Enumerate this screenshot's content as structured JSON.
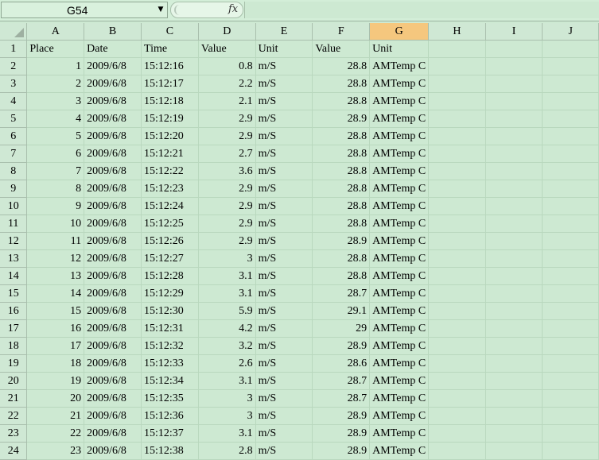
{
  "name_box": {
    "value": "G54",
    "dropdown_icon": "chevron-down-icon"
  },
  "formula": {
    "fx_label": "fx",
    "value": ""
  },
  "grid": {
    "selected_column": "G",
    "columns": [
      "A",
      "B",
      "C",
      "D",
      "E",
      "F",
      "G",
      "H",
      "I",
      "J"
    ],
    "rows": [
      {
        "n": "1",
        "cells": [
          "Place",
          "Date",
          "Time",
          "Value",
          "Unit",
          "Value",
          "Unit",
          "",
          "",
          ""
        ]
      },
      {
        "n": "2",
        "cells": [
          "1",
          "2009/6/8",
          "15:12:16",
          "0.8",
          "m/S",
          "28.8",
          "AMTemp C",
          "",
          "",
          ""
        ]
      },
      {
        "n": "3",
        "cells": [
          "2",
          "2009/6/8",
          "15:12:17",
          "2.2",
          "m/S",
          "28.8",
          "AMTemp C",
          "",
          "",
          ""
        ]
      },
      {
        "n": "4",
        "cells": [
          "3",
          "2009/6/8",
          "15:12:18",
          "2.1",
          "m/S",
          "28.8",
          "AMTemp C",
          "",
          "",
          ""
        ]
      },
      {
        "n": "5",
        "cells": [
          "4",
          "2009/6/8",
          "15:12:19",
          "2.9",
          "m/S",
          "28.9",
          "AMTemp C",
          "",
          "",
          ""
        ]
      },
      {
        "n": "6",
        "cells": [
          "5",
          "2009/6/8",
          "15:12:20",
          "2.9",
          "m/S",
          "28.8",
          "AMTemp C",
          "",
          "",
          ""
        ]
      },
      {
        "n": "7",
        "cells": [
          "6",
          "2009/6/8",
          "15:12:21",
          "2.7",
          "m/S",
          "28.8",
          "AMTemp C",
          "",
          "",
          ""
        ]
      },
      {
        "n": "8",
        "cells": [
          "7",
          "2009/6/8",
          "15:12:22",
          "3.6",
          "m/S",
          "28.8",
          "AMTemp C",
          "",
          "",
          ""
        ]
      },
      {
        "n": "9",
        "cells": [
          "8",
          "2009/6/8",
          "15:12:23",
          "2.9",
          "m/S",
          "28.8",
          "AMTemp C",
          "",
          "",
          ""
        ]
      },
      {
        "n": "10",
        "cells": [
          "9",
          "2009/6/8",
          "15:12:24",
          "2.9",
          "m/S",
          "28.8",
          "AMTemp C",
          "",
          "",
          ""
        ]
      },
      {
        "n": "11",
        "cells": [
          "10",
          "2009/6/8",
          "15:12:25",
          "2.9",
          "m/S",
          "28.8",
          "AMTemp C",
          "",
          "",
          ""
        ]
      },
      {
        "n": "12",
        "cells": [
          "11",
          "2009/6/8",
          "15:12:26",
          "2.9",
          "m/S",
          "28.9",
          "AMTemp C",
          "",
          "",
          ""
        ]
      },
      {
        "n": "13",
        "cells": [
          "12",
          "2009/6/8",
          "15:12:27",
          "3",
          "m/S",
          "28.8",
          "AMTemp C",
          "",
          "",
          ""
        ]
      },
      {
        "n": "14",
        "cells": [
          "13",
          "2009/6/8",
          "15:12:28",
          "3.1",
          "m/S",
          "28.8",
          "AMTemp C",
          "",
          "",
          ""
        ]
      },
      {
        "n": "15",
        "cells": [
          "14",
          "2009/6/8",
          "15:12:29",
          "3.1",
          "m/S",
          "28.7",
          "AMTemp C",
          "",
          "",
          ""
        ]
      },
      {
        "n": "16",
        "cells": [
          "15",
          "2009/6/8",
          "15:12:30",
          "5.9",
          "m/S",
          "29.1",
          "AMTemp C",
          "",
          "",
          ""
        ]
      },
      {
        "n": "17",
        "cells": [
          "16",
          "2009/6/8",
          "15:12:31",
          "4.2",
          "m/S",
          "29",
          "AMTemp C",
          "",
          "",
          ""
        ]
      },
      {
        "n": "18",
        "cells": [
          "17",
          "2009/6/8",
          "15:12:32",
          "3.2",
          "m/S",
          "28.9",
          "AMTemp C",
          "",
          "",
          ""
        ]
      },
      {
        "n": "19",
        "cells": [
          "18",
          "2009/6/8",
          "15:12:33",
          "2.6",
          "m/S",
          "28.6",
          "AMTemp C",
          "",
          "",
          ""
        ]
      },
      {
        "n": "20",
        "cells": [
          "19",
          "2009/6/8",
          "15:12:34",
          "3.1",
          "m/S",
          "28.7",
          "AMTemp C",
          "",
          "",
          ""
        ]
      },
      {
        "n": "21",
        "cells": [
          "20",
          "2009/6/8",
          "15:12:35",
          "3",
          "m/S",
          "28.7",
          "AMTemp C",
          "",
          "",
          ""
        ]
      },
      {
        "n": "22",
        "cells": [
          "21",
          "2009/6/8",
          "15:12:36",
          "3",
          "m/S",
          "28.9",
          "AMTemp C",
          "",
          "",
          ""
        ]
      },
      {
        "n": "23",
        "cells": [
          "22",
          "2009/6/8",
          "15:12:37",
          "3.1",
          "m/S",
          "28.9",
          "AMTemp C",
          "",
          "",
          ""
        ]
      },
      {
        "n": "24",
        "cells": [
          "23",
          "2009/6/8",
          "15:12:38",
          "2.8",
          "m/S",
          "28.9",
          "AMTemp C",
          "",
          "",
          ""
        ]
      }
    ]
  }
}
